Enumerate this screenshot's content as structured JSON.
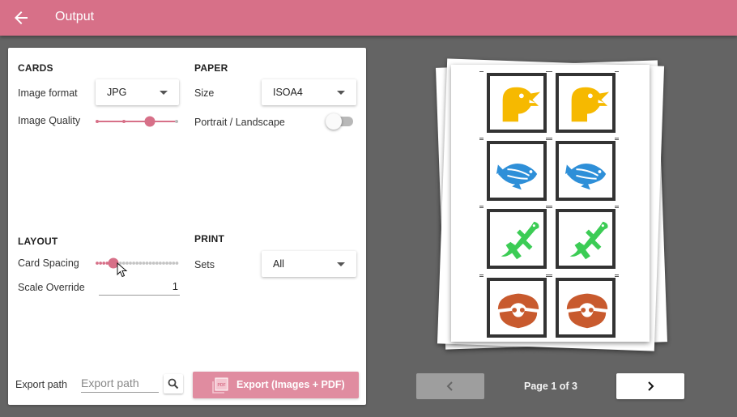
{
  "appbar": {
    "title": "Output"
  },
  "cards": {
    "heading": "CARDS",
    "image_format_label": "Image format",
    "image_format_value": "JPG",
    "image_quality_label": "Image Quality",
    "image_quality_level": 0.65
  },
  "paper": {
    "heading": "PAPER",
    "size_label": "Size",
    "size_value": "ISOA4",
    "orientation_label": "Portrait / Landscape",
    "landscape_enabled": false
  },
  "layout": {
    "heading": "LAYOUT",
    "card_spacing_label": "Card Spacing",
    "card_spacing_level": 0.2,
    "scale_override_label": "Scale Override",
    "scale_override_value": "1"
  },
  "print": {
    "heading": "PRINT",
    "sets_label": "Sets",
    "sets_value": "All"
  },
  "export": {
    "path_label": "Export path",
    "path_placeholder": "Export path",
    "button_label": "Export (Images + PDF)",
    "button_icon": "pdf-icon"
  },
  "preview": {
    "cards": [
      "bird",
      "bird",
      "fish",
      "fish",
      "lizard",
      "lizard",
      "crab",
      "crab"
    ],
    "card_colors": {
      "bird": "#f6b900",
      "fish": "#2e8fd8",
      "lizard": "#3ccc55",
      "crab": "#c85a2e"
    }
  },
  "pagination": {
    "page_label": "Page 1 of 3",
    "prev_icon": "chevron-left-icon",
    "next_icon": "chevron-right-icon"
  },
  "colors": {
    "accent": "#d77088",
    "accent_light": "#e08ca0",
    "background": "#646464"
  }
}
